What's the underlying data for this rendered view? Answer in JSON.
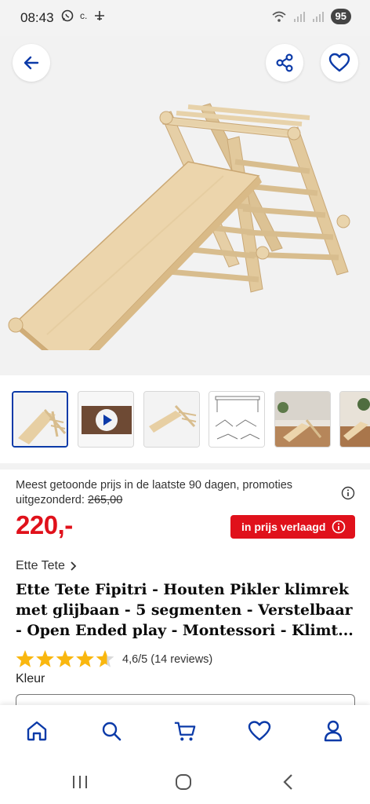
{
  "status": {
    "time": "08:43",
    "carrier_text": "c.",
    "battery": "95"
  },
  "gallery": {
    "thumbnails": [
      {
        "name": "thumb-slide-front",
        "selected": true
      },
      {
        "name": "thumb-video",
        "selected": false
      },
      {
        "name": "thumb-slide-side",
        "selected": false
      },
      {
        "name": "thumb-parts",
        "selected": false
      },
      {
        "name": "thumb-room",
        "selected": false
      },
      {
        "name": "thumb-room-2",
        "selected": false
      }
    ]
  },
  "price": {
    "note": "Meest getoonde prijs in de laatste 90 dagen, promoties uitgezonderd:",
    "old_price": "265,00",
    "current": "220,-",
    "badge": "in prijs verlaagd"
  },
  "product": {
    "brand": "Ette Tete",
    "title": "Ette Tete Fipitri - Houten Pikler klimrek met glijbaan - 5 segmenten - Verstelbaar - Open Ended play - Montessori - Klimt...",
    "rating_value": 4.6,
    "rating_max": 5,
    "rating_text": "4,6/5 (14 reviews)",
    "color_label": "Kleur"
  },
  "colors": {
    "brand_blue": "#0b3aa8",
    "price_red": "#e0111b",
    "star_yellow": "#f9b70f"
  },
  "icons": {
    "back": "arrow-left-icon",
    "share": "share-icon",
    "favorite": "heart-icon",
    "info": "info-icon",
    "chevron": "chevron-right-icon",
    "nav": [
      "home-icon",
      "search-icon",
      "cart-icon",
      "heart-icon",
      "user-icon"
    ],
    "system": [
      "recents-icon",
      "home-circle-icon",
      "back-chevron-icon"
    ]
  }
}
